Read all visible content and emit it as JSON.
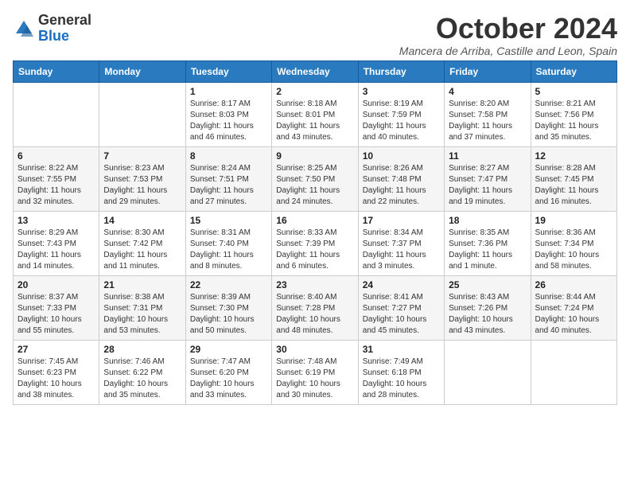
{
  "header": {
    "logo_general": "General",
    "logo_blue": "Blue",
    "title": "October 2024",
    "subtitle": "Mancera de Arriba, Castille and Leon, Spain"
  },
  "days_of_week": [
    "Sunday",
    "Monday",
    "Tuesday",
    "Wednesday",
    "Thursday",
    "Friday",
    "Saturday"
  ],
  "weeks": [
    [
      {
        "day": "",
        "info": ""
      },
      {
        "day": "",
        "info": ""
      },
      {
        "day": "1",
        "info": "Sunrise: 8:17 AM\nSunset: 8:03 PM\nDaylight: 11 hours and 46 minutes."
      },
      {
        "day": "2",
        "info": "Sunrise: 8:18 AM\nSunset: 8:01 PM\nDaylight: 11 hours and 43 minutes."
      },
      {
        "day": "3",
        "info": "Sunrise: 8:19 AM\nSunset: 7:59 PM\nDaylight: 11 hours and 40 minutes."
      },
      {
        "day": "4",
        "info": "Sunrise: 8:20 AM\nSunset: 7:58 PM\nDaylight: 11 hours and 37 minutes."
      },
      {
        "day": "5",
        "info": "Sunrise: 8:21 AM\nSunset: 7:56 PM\nDaylight: 11 hours and 35 minutes."
      }
    ],
    [
      {
        "day": "6",
        "info": "Sunrise: 8:22 AM\nSunset: 7:55 PM\nDaylight: 11 hours and 32 minutes."
      },
      {
        "day": "7",
        "info": "Sunrise: 8:23 AM\nSunset: 7:53 PM\nDaylight: 11 hours and 29 minutes."
      },
      {
        "day": "8",
        "info": "Sunrise: 8:24 AM\nSunset: 7:51 PM\nDaylight: 11 hours and 27 minutes."
      },
      {
        "day": "9",
        "info": "Sunrise: 8:25 AM\nSunset: 7:50 PM\nDaylight: 11 hours and 24 minutes."
      },
      {
        "day": "10",
        "info": "Sunrise: 8:26 AM\nSunset: 7:48 PM\nDaylight: 11 hours and 22 minutes."
      },
      {
        "day": "11",
        "info": "Sunrise: 8:27 AM\nSunset: 7:47 PM\nDaylight: 11 hours and 19 minutes."
      },
      {
        "day": "12",
        "info": "Sunrise: 8:28 AM\nSunset: 7:45 PM\nDaylight: 11 hours and 16 minutes."
      }
    ],
    [
      {
        "day": "13",
        "info": "Sunrise: 8:29 AM\nSunset: 7:43 PM\nDaylight: 11 hours and 14 minutes."
      },
      {
        "day": "14",
        "info": "Sunrise: 8:30 AM\nSunset: 7:42 PM\nDaylight: 11 hours and 11 minutes."
      },
      {
        "day": "15",
        "info": "Sunrise: 8:31 AM\nSunset: 7:40 PM\nDaylight: 11 hours and 8 minutes."
      },
      {
        "day": "16",
        "info": "Sunrise: 8:33 AM\nSunset: 7:39 PM\nDaylight: 11 hours and 6 minutes."
      },
      {
        "day": "17",
        "info": "Sunrise: 8:34 AM\nSunset: 7:37 PM\nDaylight: 11 hours and 3 minutes."
      },
      {
        "day": "18",
        "info": "Sunrise: 8:35 AM\nSunset: 7:36 PM\nDaylight: 11 hours and 1 minute."
      },
      {
        "day": "19",
        "info": "Sunrise: 8:36 AM\nSunset: 7:34 PM\nDaylight: 10 hours and 58 minutes."
      }
    ],
    [
      {
        "day": "20",
        "info": "Sunrise: 8:37 AM\nSunset: 7:33 PM\nDaylight: 10 hours and 55 minutes."
      },
      {
        "day": "21",
        "info": "Sunrise: 8:38 AM\nSunset: 7:31 PM\nDaylight: 10 hours and 53 minutes."
      },
      {
        "day": "22",
        "info": "Sunrise: 8:39 AM\nSunset: 7:30 PM\nDaylight: 10 hours and 50 minutes."
      },
      {
        "day": "23",
        "info": "Sunrise: 8:40 AM\nSunset: 7:28 PM\nDaylight: 10 hours and 48 minutes."
      },
      {
        "day": "24",
        "info": "Sunrise: 8:41 AM\nSunset: 7:27 PM\nDaylight: 10 hours and 45 minutes."
      },
      {
        "day": "25",
        "info": "Sunrise: 8:43 AM\nSunset: 7:26 PM\nDaylight: 10 hours and 43 minutes."
      },
      {
        "day": "26",
        "info": "Sunrise: 8:44 AM\nSunset: 7:24 PM\nDaylight: 10 hours and 40 minutes."
      }
    ],
    [
      {
        "day": "27",
        "info": "Sunrise: 7:45 AM\nSunset: 6:23 PM\nDaylight: 10 hours and 38 minutes."
      },
      {
        "day": "28",
        "info": "Sunrise: 7:46 AM\nSunset: 6:22 PM\nDaylight: 10 hours and 35 minutes."
      },
      {
        "day": "29",
        "info": "Sunrise: 7:47 AM\nSunset: 6:20 PM\nDaylight: 10 hours and 33 minutes."
      },
      {
        "day": "30",
        "info": "Sunrise: 7:48 AM\nSunset: 6:19 PM\nDaylight: 10 hours and 30 minutes."
      },
      {
        "day": "31",
        "info": "Sunrise: 7:49 AM\nSunset: 6:18 PM\nDaylight: 10 hours and 28 minutes."
      },
      {
        "day": "",
        "info": ""
      },
      {
        "day": "",
        "info": ""
      }
    ]
  ]
}
